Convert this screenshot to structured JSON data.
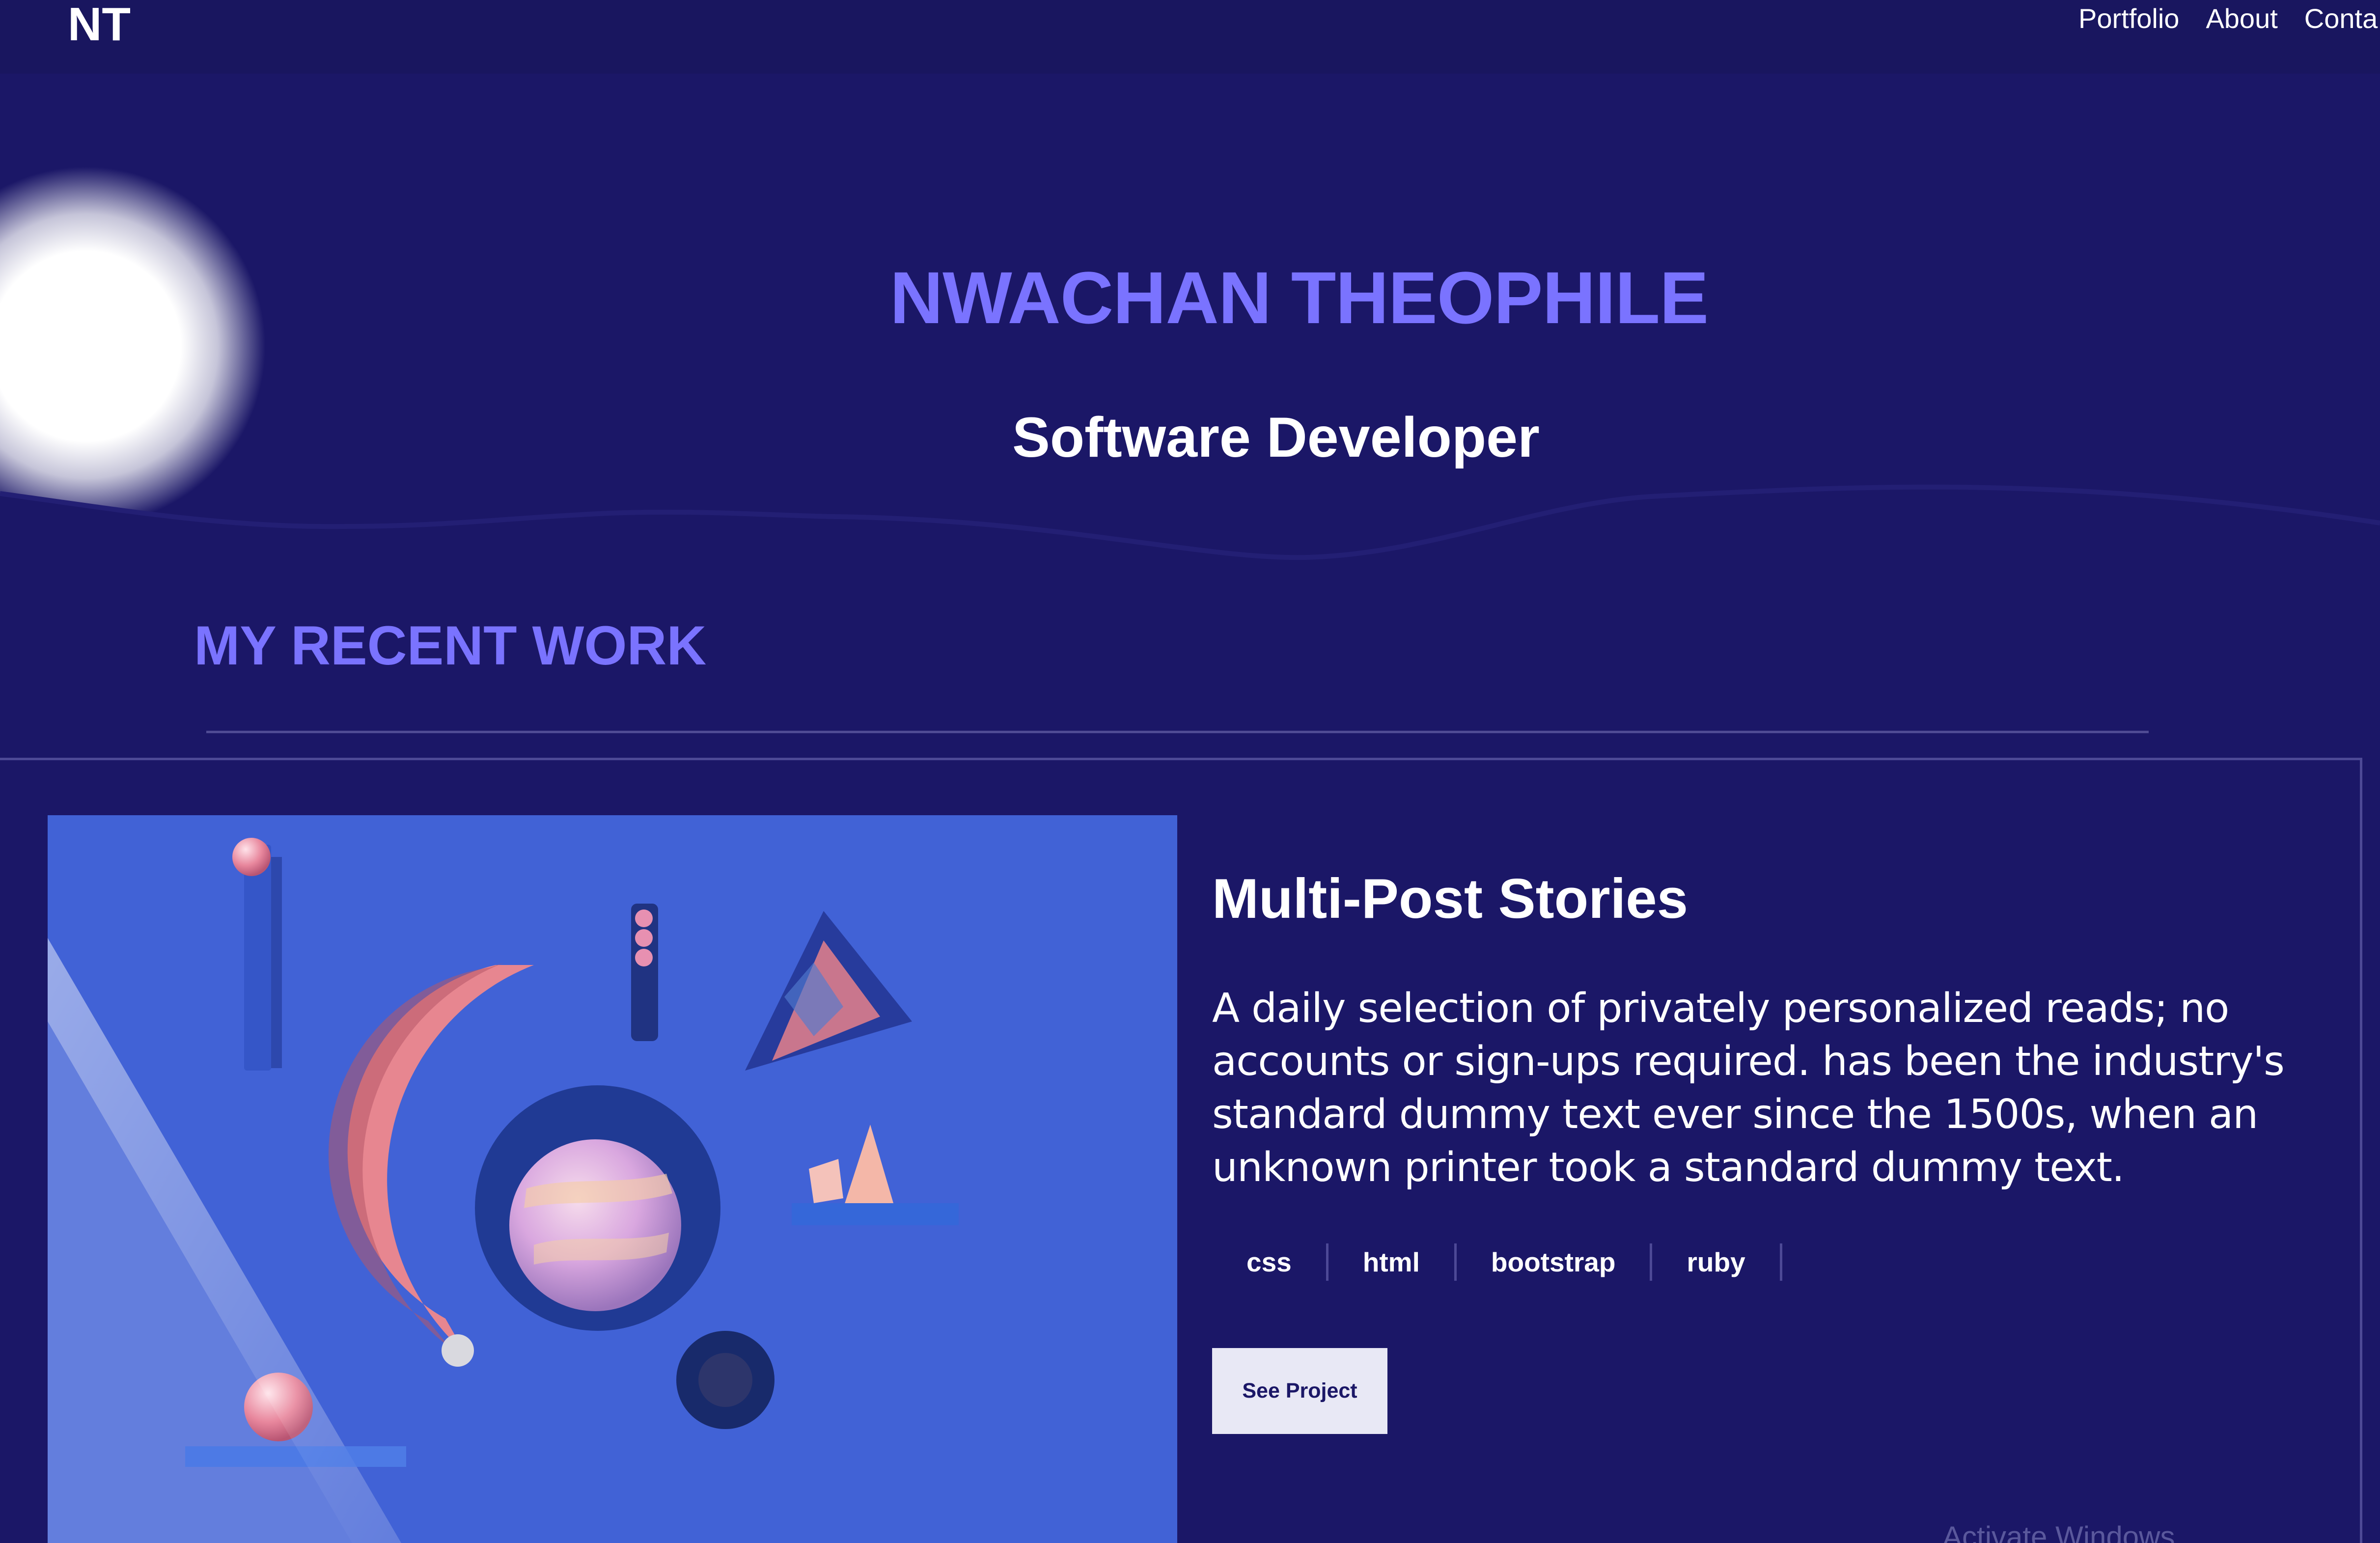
{
  "header": {
    "logo": "NT",
    "nav_items": [
      {
        "label": "Portfolio"
      },
      {
        "label": "About"
      },
      {
        "label": "Conta"
      }
    ]
  },
  "hero": {
    "title": "NWACHAN THEOPHILE",
    "subtitle": "Software Developer"
  },
  "recent_work": {
    "title": "MY RECENT WORK",
    "project": {
      "title": "Multi-Post Stories",
      "description": "A daily selection of privately personalized reads; no accounts or sign-ups required. has been the industry's standard dummy text ever since the 1500s, when an unknown printer took a standard dummy text.",
      "tags": [
        "css",
        "html",
        "bootstrap",
        "ruby"
      ],
      "button_label": "See Project"
    }
  },
  "system_overlay": {
    "watermark": "Activate Windows"
  },
  "colors": {
    "background": "#1b1767",
    "accent": "#7a73ff",
    "text": "#ffffff",
    "button_bg": "#e8e8f5",
    "project_image_blue": "#4463d7"
  }
}
